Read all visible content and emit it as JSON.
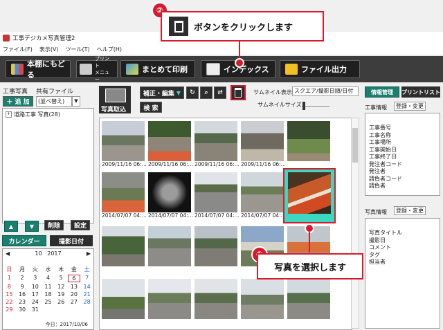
{
  "window": {
    "title": "工事デジカメ写真管理2"
  },
  "menu": [
    "ファイル(F)",
    "表示(V)",
    "ツール(T)",
    "ヘルプ(H)"
  ],
  "toolbar": {
    "back": "本棚にもどる",
    "print_small_1": "プリント",
    "print_small_2": "メニュー",
    "batch_print": "まとめて印刷",
    "index": "インデックス",
    "file_output": "ファイル出力"
  },
  "left": {
    "header_left": "工事写真",
    "header_right": "共有ファイル",
    "add_label": "＋ 追 加",
    "sort_label": "(並べ替え)",
    "tree_item": "道路工事  写真(28)",
    "delete_label": "削除",
    "settings_label": "設定",
    "tab_calendar": "カレンダー",
    "tab_shot_date": "撮影日付",
    "cal_month": "10",
    "cal_year": "2017",
    "weekdays": [
      "日",
      "月",
      "火",
      "水",
      "木",
      "金",
      "土"
    ],
    "days": [
      "1",
      "2",
      "3",
      "4",
      "5",
      "6",
      "7",
      "8",
      "9",
      "10",
      "11",
      "12",
      "13",
      "14",
      "15",
      "16",
      "17",
      "18",
      "19",
      "20",
      "21",
      "22",
      "23",
      "24",
      "25",
      "26",
      "27",
      "28",
      "29",
      "30",
      "31",
      "",
      "",
      "",
      ""
    ],
    "today_text": "今日：2017/10/06"
  },
  "center": {
    "import_label": "写真取込",
    "correct_edit_label": "補正・編集",
    "search_label": "検 索",
    "thumbnail_display_label": "サムネイル表示",
    "thumbnail_display_value": "スクエア/撮影日順/日付",
    "thumbnail_size_label": "サムネイルサイズ",
    "captions": [
      "2009/11/16 06:...",
      "2009/11/16 06:...",
      "2009/11/16 06:...",
      "2009/11/16 06:...",
      "",
      "2014/07/07 04:...",
      "2014/07/07 04:...",
      "2014/07/07 04:...",
      "2014/07/07 04:...",
      ""
    ]
  },
  "right": {
    "tab_info": "情報管理",
    "tab_print_list": "プリントリスト",
    "construction_info_label": "工事情報",
    "construction_register": "登録・変更",
    "construction_fields": [
      "工事番号",
      "工事名称",
      "工事場所",
      "工事開始日",
      "工事終了日",
      "発注者コード",
      "発注者",
      "請負者コード",
      "請負者"
    ],
    "photo_info_label": "写真情報",
    "photo_register": "登録・変更",
    "photo_fields": [
      "写真タイトル",
      "撮影日",
      "コメント",
      "タグ",
      "担当者"
    ]
  },
  "callouts": {
    "one_number": "①",
    "one_text": "写真を選択します",
    "two_number": "②",
    "two_text": "ボタンをクリックします"
  },
  "colors": {
    "accent_red": "#d81b2c",
    "toolbar_bg": "#3d3d3d",
    "teal": "#1a7f6e",
    "selection": "#3dd6c0"
  }
}
